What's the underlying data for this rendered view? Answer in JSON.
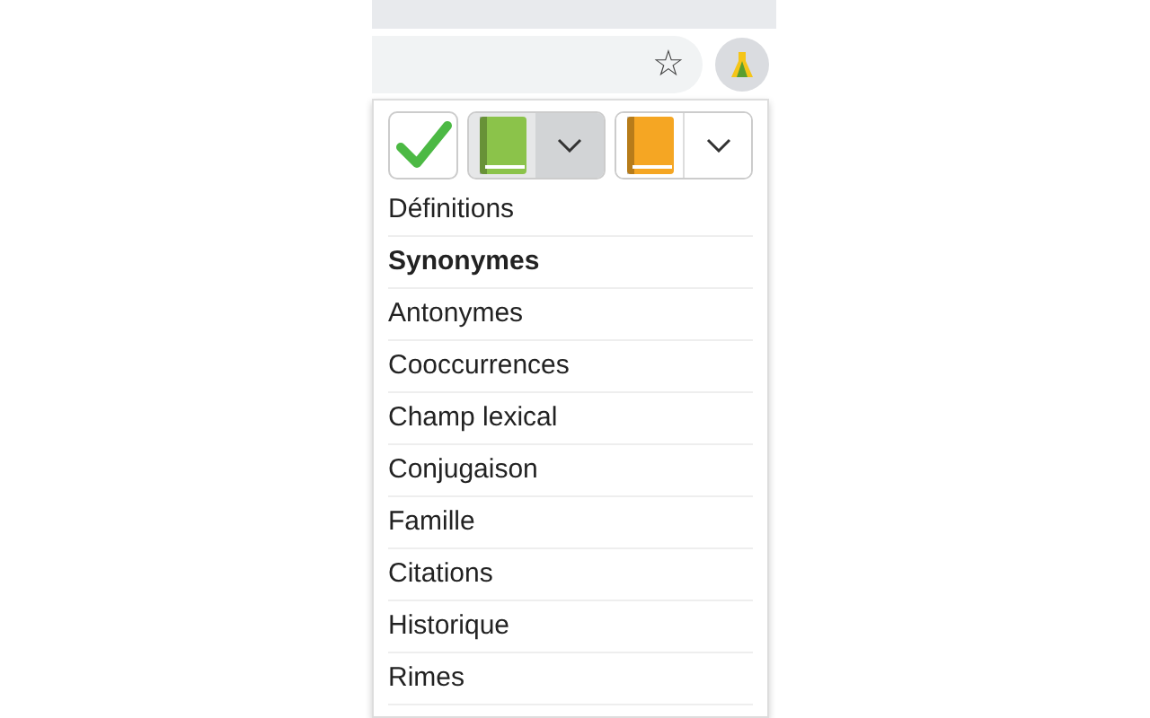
{
  "toolbar": {
    "star": "☆"
  },
  "popup": {
    "buttons": [
      {
        "kind": "check"
      },
      {
        "kind": "book",
        "color": "#8bc34a",
        "pressed": true
      },
      {
        "kind": "book",
        "color": "#f5a623",
        "pressed": false
      }
    ],
    "items": [
      {
        "label": "Définitions",
        "selected": false
      },
      {
        "label": "Synonymes",
        "selected": true
      },
      {
        "label": "Antonymes",
        "selected": false
      },
      {
        "label": "Cooccurrences",
        "selected": false
      },
      {
        "label": "Champ lexical",
        "selected": false
      },
      {
        "label": "Conjugaison",
        "selected": false
      },
      {
        "label": "Famille",
        "selected": false
      },
      {
        "label": "Citations",
        "selected": false
      },
      {
        "label": "Historique",
        "selected": false
      },
      {
        "label": "Rimes",
        "selected": false
      }
    ]
  }
}
